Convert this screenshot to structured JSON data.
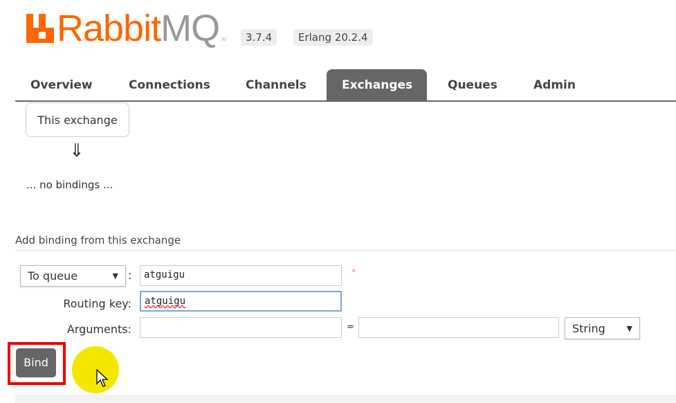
{
  "header": {
    "logo_primary": "Rabbit",
    "logo_secondary": "MQ",
    "logo_tm": "TM",
    "version": "3.7.4",
    "erlang": "Erlang 20.2.4",
    "brand_color": "#ff6600"
  },
  "tabs": [
    {
      "label": "Overview"
    },
    {
      "label": "Connections"
    },
    {
      "label": "Channels"
    },
    {
      "label": "Exchanges",
      "active": true
    },
    {
      "label": "Queues"
    },
    {
      "label": "Admin"
    }
  ],
  "bindings": {
    "source_box": "This exchange",
    "arrow": "⇓",
    "empty": "... no bindings ..."
  },
  "form": {
    "title": "Add binding from this exchange",
    "destination_type": "To queue",
    "colon": ":",
    "destination_value": "atguigu",
    "required_mark": "*",
    "routing_key_label": "Routing key:",
    "routing_key_value": "atguigu",
    "arguments_label": "Arguments:",
    "arg_key": "",
    "equals": "=",
    "arg_value": "",
    "arg_type": "String",
    "bind_label": "Bind"
  }
}
